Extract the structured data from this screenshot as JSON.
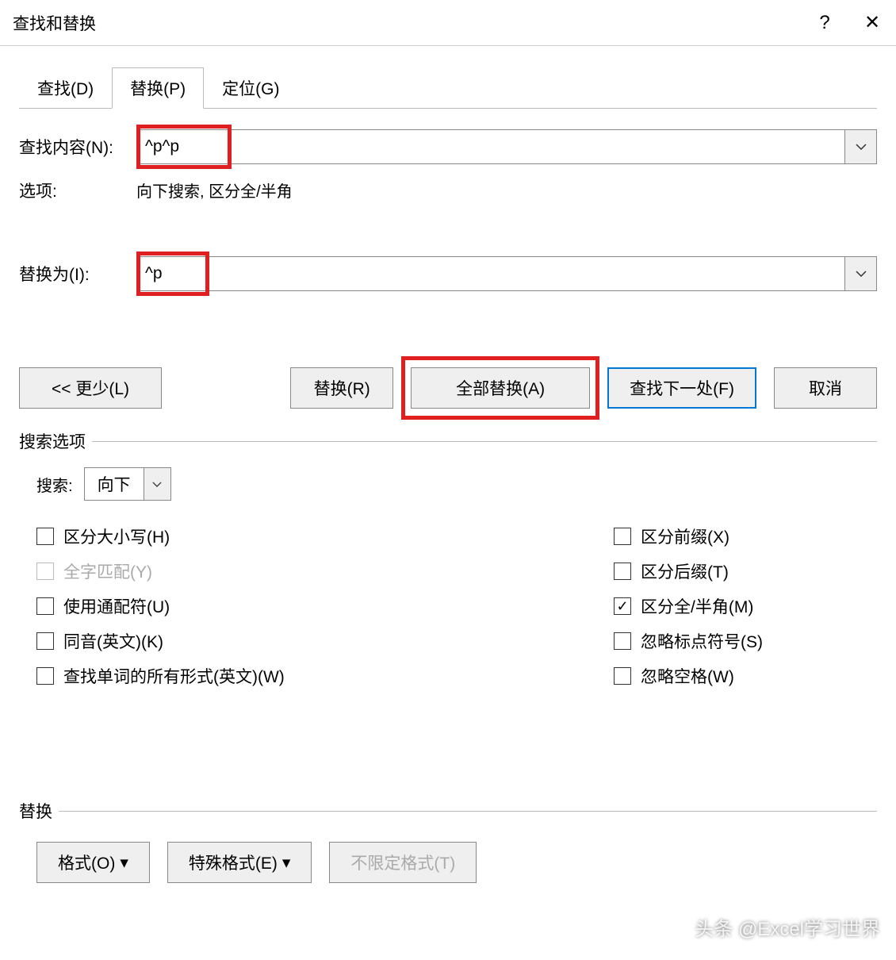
{
  "titlebar": {
    "title": "查找和替换",
    "help": "?",
    "close": "✕"
  },
  "tabs": [
    {
      "label": "查找(D)"
    },
    {
      "label": "替换(P)"
    },
    {
      "label": "定位(G)"
    }
  ],
  "find": {
    "label": "查找内容(N):",
    "value": "^p^p"
  },
  "options_label": "选项:",
  "options_value": "向下搜索, 区分全/半角",
  "replace": {
    "label": "替换为(I):",
    "value": "^p"
  },
  "buttons": {
    "less": "<< 更少(L)",
    "replace": "替换(R)",
    "replace_all": "全部替换(A)",
    "find_next": "查找下一处(F)",
    "cancel": "取消"
  },
  "search_options_legend": "搜索选项",
  "search_dir_label": "搜索:",
  "search_dir_value": "向下",
  "checks_left": [
    {
      "label": "区分大小写(H)",
      "checked": false,
      "disabled": false
    },
    {
      "label": "全字匹配(Y)",
      "checked": false,
      "disabled": true
    },
    {
      "label": "使用通配符(U)",
      "checked": false,
      "disabled": false
    },
    {
      "label": "同音(英文)(K)",
      "checked": false,
      "disabled": false
    },
    {
      "label": "查找单词的所有形式(英文)(W)",
      "checked": false,
      "disabled": false
    }
  ],
  "checks_right": [
    {
      "label": "区分前缀(X)",
      "checked": false
    },
    {
      "label": "区分后缀(T)",
      "checked": false
    },
    {
      "label": "区分全/半角(M)",
      "checked": true
    },
    {
      "label": "忽略标点符号(S)",
      "checked": false
    },
    {
      "label": "忽略空格(W)",
      "checked": false
    }
  ],
  "replace_legend": "替换",
  "format_btn": "格式(O)",
  "special_btn": "特殊格式(E)",
  "noformat_btn": "不限定格式(T)",
  "watermark": "头条 @Excel学习世界"
}
